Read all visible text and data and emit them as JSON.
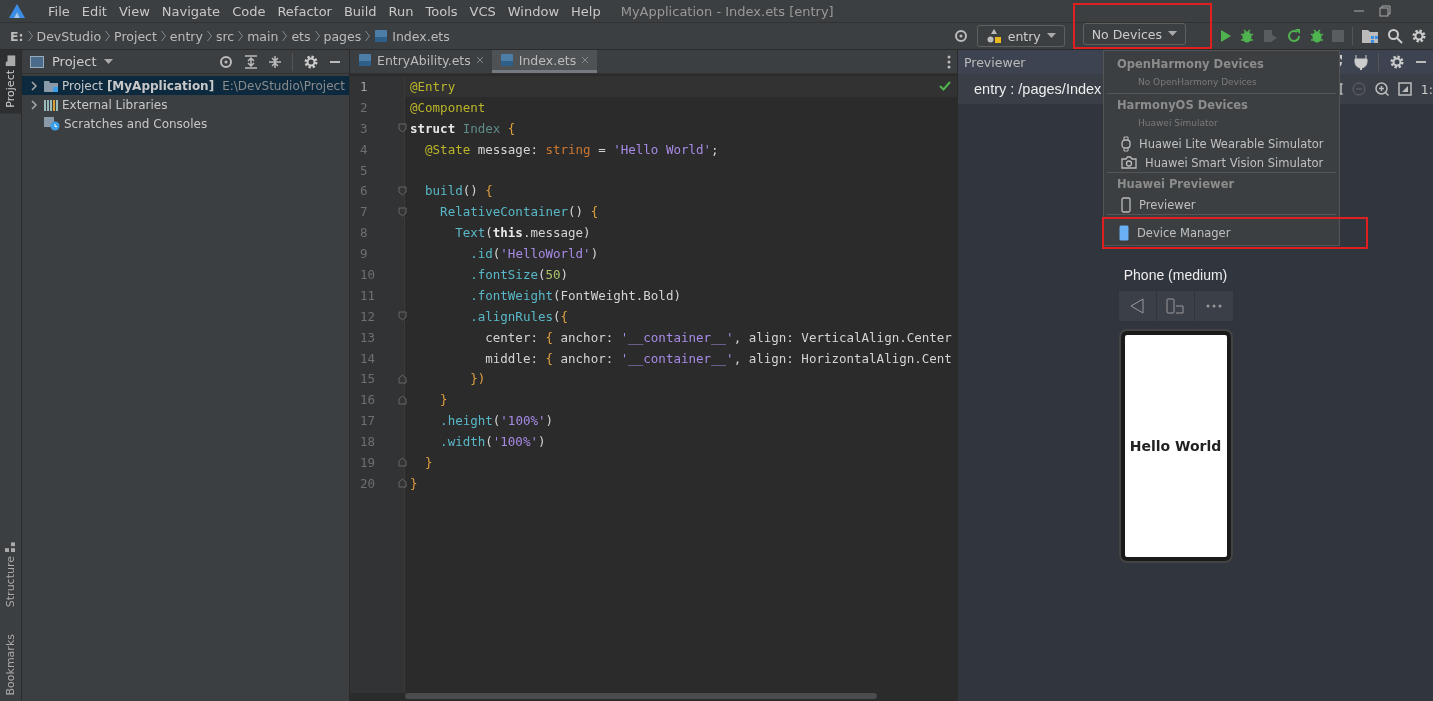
{
  "menu_bar": {
    "items": [
      "File",
      "Edit",
      "View",
      "Navigate",
      "Code",
      "Refactor",
      "Build",
      "Run",
      "Tools",
      "VCS",
      "Window",
      "Help"
    ],
    "title": "MyApplication - Index.ets [entry]"
  },
  "breadcrumb": [
    "E:",
    "DevStudio",
    "Project",
    "entry",
    "src",
    "main",
    "ets",
    "pages",
    "Index.ets"
  ],
  "toolbar": {
    "module": "entry",
    "device": "No Devices",
    "device_highlighted": true
  },
  "side_tabs": [
    {
      "label": "Project",
      "selected": true
    },
    {
      "label": "Structure",
      "selected": false
    },
    {
      "label": "Bookmarks",
      "selected": false
    }
  ],
  "project_panel": {
    "title": "Project",
    "tree": [
      {
        "kind": "group",
        "label": "Project **[MyApplication]**",
        "path": "E:\\DevStudio\\Project",
        "expanded": false,
        "selected": true
      },
      {
        "kind": "group",
        "label": "External Libraries",
        "expanded": false,
        "selected": false
      },
      {
        "kind": "leaf",
        "label": "Scratches and Consoles",
        "selected": false
      }
    ]
  },
  "editor": {
    "tabs": [
      {
        "label": "EntryAbility.ets",
        "selected": false
      },
      {
        "label": "Index.ets",
        "selected": true
      }
    ],
    "lines": [
      {
        "number": "1",
        "kind": "plain",
        "current": true,
        "tokens": [
          {
            "kind": "ann",
            "text": "@Entry"
          }
        ]
      },
      {
        "number": "2",
        "kind": "plain",
        "current": false,
        "tokens": [
          {
            "kind": "ann",
            "text": "@Component"
          }
        ]
      },
      {
        "number": "3",
        "kind": "fold_start",
        "current": false,
        "tokens": [
          {
            "kind": "kw",
            "text": "struct "
          },
          {
            "kind": "cls",
            "text": "Index "
          },
          {
            "kind": "br",
            "text": "{"
          }
        ]
      },
      {
        "number": "4",
        "kind": "plain",
        "current": false,
        "tokens": [
          {
            "kind": "ann",
            "text": "  @State"
          },
          {
            "kind": "p",
            "text": " message: "
          },
          {
            "kind": "type",
            "text": "string"
          },
          {
            "kind": "p",
            "text": " = "
          },
          {
            "kind": "str",
            "text": "'Hello World'"
          },
          {
            "kind": "p",
            "text": ";"
          }
        ]
      },
      {
        "number": "5",
        "kind": "plain",
        "current": false
      },
      {
        "number": "6",
        "kind": "fold_start",
        "current": false,
        "tokens": [
          {
            "kind": "fn",
            "text": "  build"
          },
          {
            "kind": "p",
            "text": "() "
          },
          {
            "kind": "br",
            "text": "{"
          }
        ]
      },
      {
        "number": "7",
        "kind": "fold_start",
        "current": false,
        "tokens": [
          {
            "kind": "fn",
            "text": "    RelativeContainer"
          },
          {
            "kind": "p",
            "text": "() "
          },
          {
            "kind": "br",
            "text": "{"
          }
        ]
      },
      {
        "number": "8",
        "kind": "plain",
        "current": false,
        "tokens": [
          {
            "kind": "fn",
            "text": "      Text"
          },
          {
            "kind": "p",
            "text": "("
          },
          {
            "kind": "kw",
            "text": "this"
          },
          {
            "kind": "p",
            "text": ".message)"
          }
        ]
      },
      {
        "number": "9",
        "kind": "plain",
        "current": false,
        "tokens": [
          {
            "kind": "fn",
            "text": "        .id"
          },
          {
            "kind": "p",
            "text": "("
          },
          {
            "kind": "str",
            "text": "'HelloWorld'"
          },
          {
            "kind": "p",
            "text": ")"
          }
        ]
      },
      {
        "number": "10",
        "kind": "plain",
        "current": false,
        "tokens": [
          {
            "kind": "fn",
            "text": "        .fontSize"
          },
          {
            "kind": "p",
            "text": "("
          },
          {
            "kind": "num",
            "text": "50"
          },
          {
            "kind": "p",
            "text": ")"
          }
        ]
      },
      {
        "number": "11",
        "kind": "plain",
        "current": false,
        "tokens": [
          {
            "kind": "fn",
            "text": "        .fontWeight"
          },
          {
            "kind": "p",
            "text": "(FontWeight.Bold)"
          }
        ]
      },
      {
        "number": "12",
        "kind": "fold_start",
        "current": false,
        "tokens": [
          {
            "kind": "fn",
            "text": "        .alignRules"
          },
          {
            "kind": "p",
            "text": "("
          },
          {
            "kind": "br",
            "text": "{"
          }
        ]
      },
      {
        "number": "13",
        "kind": "plain",
        "current": false,
        "tokens": [
          {
            "kind": "p",
            "text": "          center: "
          },
          {
            "kind": "br",
            "text": "{"
          },
          {
            "kind": "p",
            "text": " anchor: "
          },
          {
            "kind": "str",
            "text": "'__container__'"
          },
          {
            "kind": "p",
            "text": ", align: VerticalAlign.Center"
          }
        ]
      },
      {
        "number": "14",
        "kind": "plain",
        "current": false,
        "tokens": [
          {
            "kind": "p",
            "text": "          middle: "
          },
          {
            "kind": "br",
            "text": "{"
          },
          {
            "kind": "p",
            "text": " anchor: "
          },
          {
            "kind": "str",
            "text": "'__container__'"
          },
          {
            "kind": "p",
            "text": ", align: HorizontalAlign.Cent"
          }
        ]
      },
      {
        "number": "15",
        "kind": "fold_end",
        "current": false,
        "tokens": [
          {
            "kind": "br",
            "text": "        })"
          }
        ]
      },
      {
        "number": "16",
        "kind": "fold_end",
        "current": false,
        "tokens": [
          {
            "kind": "br",
            "text": "    }"
          }
        ]
      },
      {
        "number": "17",
        "kind": "plain",
        "current": false,
        "tokens": [
          {
            "kind": "fn",
            "text": "    .height"
          },
          {
            "kind": "p",
            "text": "("
          },
          {
            "kind": "str",
            "text": "'100%'"
          },
          {
            "kind": "p",
            "text": ")"
          }
        ]
      },
      {
        "number": "18",
        "kind": "plain",
        "current": false,
        "tokens": [
          {
            "kind": "fn",
            "text": "    .width"
          },
          {
            "kind": "p",
            "text": "("
          },
          {
            "kind": "str",
            "text": "'100%'"
          },
          {
            "kind": "p",
            "text": ")"
          }
        ]
      },
      {
        "number": "19",
        "kind": "fold_end",
        "current": false,
        "tokens": [
          {
            "kind": "br",
            "text": "  }"
          }
        ]
      },
      {
        "number": "20",
        "kind": "fold_end",
        "current": false,
        "tokens": [
          {
            "kind": "br",
            "text": "}"
          }
        ]
      }
    ]
  },
  "previewer": {
    "title": "Previewer",
    "page": "entry : /pages/Index",
    "zoom": "1:",
    "device_name": "Phone (medium)",
    "screen_text": "Hello World"
  },
  "device_menu": {
    "sections": [
      {
        "title": "OpenHarmony Devices",
        "note": "No OpenHarmony Devices"
      },
      {
        "title": "HarmonyOS Devices",
        "note": "Huawei Simulator",
        "items": [
          {
            "label": "Huawei Lite Wearable Simulator",
            "highlighted": false
          },
          {
            "label": "Huawei Smart Vision Simulator",
            "highlighted": false
          }
        ]
      },
      {
        "title": "Huawei Previewer",
        "items": [
          {
            "label": "Previewer",
            "highlighted": false
          }
        ]
      },
      {
        "items": [
          {
            "label": "Device Manager",
            "highlighted": true
          }
        ]
      }
    ]
  }
}
